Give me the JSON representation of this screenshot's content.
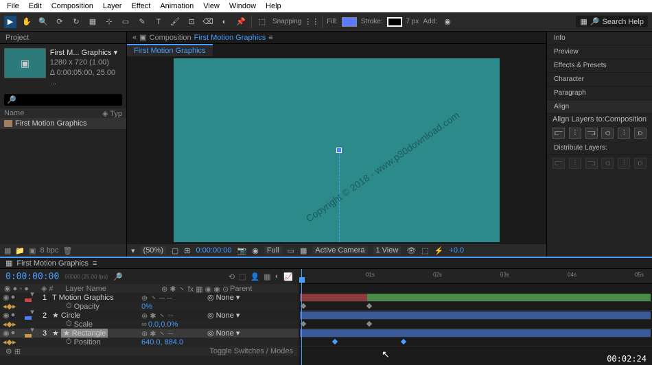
{
  "menu": {
    "items": [
      "File",
      "Edit",
      "Composition",
      "Layer",
      "Effect",
      "Animation",
      "View",
      "Window",
      "Help"
    ]
  },
  "toolbar": {
    "snapping": "Snapping",
    "fill": "Fill:",
    "stroke": "Stroke:",
    "strokepx": "7 px",
    "add": "Add:",
    "search_ph": "Search Help"
  },
  "project": {
    "title": "Project",
    "name": "First M... Graphics ▾",
    "dims": "1280 x 720 (1.00)",
    "dur": "Δ 0:00:05:00, 25.00 ...",
    "item": "First Motion Graphics",
    "cols": {
      "name": "Name",
      "type": "Typ"
    },
    "bpc": "8 bpc"
  },
  "comp": {
    "label": "Composition",
    "name": "First Motion Graphics",
    "tab": "First Motion Graphics",
    "zoom": "(50%)",
    "tc": "0:00:00:00",
    "res": "Full",
    "cam": "Active Camera",
    "view": "1 View",
    "exp": "+0.0"
  },
  "panels": {
    "info": "Info",
    "preview": "Preview",
    "effects": "Effects & Presets",
    "character": "Character",
    "paragraph": "Paragraph",
    "align": "Align",
    "alignto": "Align Layers to:",
    "aligntarget": "Composition",
    "dist": "Distribute Layers:"
  },
  "timeline": {
    "tab": "First Motion Graphics",
    "tc": "0:00:00:00",
    "fr": "00000 (25.00 fps)",
    "hdr": {
      "layer": "Layer Name",
      "parent": "Parent",
      "none": "None"
    },
    "layers": [
      {
        "n": "1",
        "name": "T Motion Graphics",
        "color": "r"
      },
      {
        "prop": "Opacity",
        "val": "0%"
      },
      {
        "n": "2",
        "name": "★ Circle",
        "color": "b"
      },
      {
        "prop": "Scale",
        "val": "0.0,0.0%"
      },
      {
        "n": "3",
        "name": "★ Rectangle",
        "color": "y",
        "sel": true
      },
      {
        "prop": "Position",
        "val": "640.0, 884.0"
      }
    ],
    "toggle": "Toggle Switches / Modes",
    "ticks": [
      "01s",
      "02s",
      "03s",
      "04s",
      "05s"
    ]
  },
  "watermark": "Copyright © 2018 - www.p30download.com",
  "videotc": "00:02:24"
}
